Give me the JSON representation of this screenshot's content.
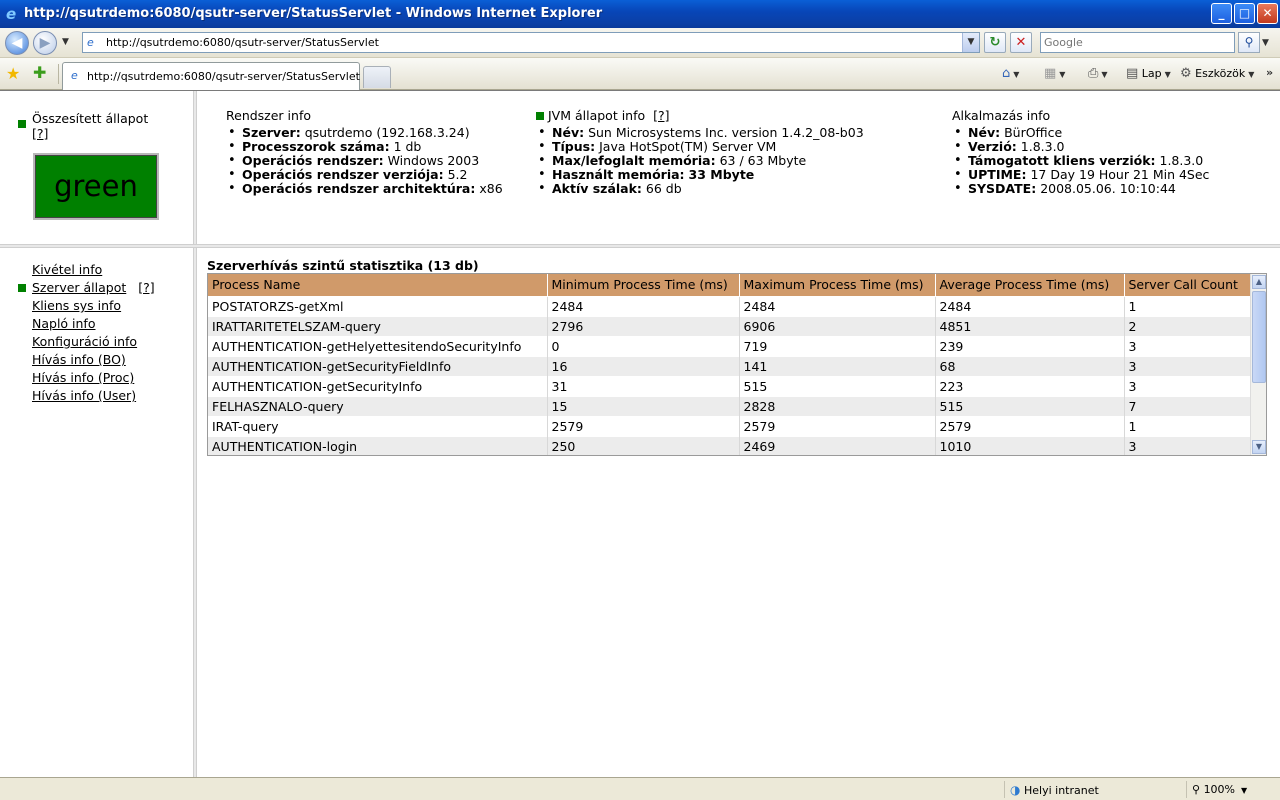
{
  "window": {
    "title": "http://qsutrdemo:6080/qsutr-server/StatusServlet - Windows Internet Explorer",
    "minimize": "_",
    "maximize": "□",
    "close": "✕"
  },
  "address_bar": {
    "url": "http://qsutrdemo:6080/qsutr-server/StatusServlet",
    "search_placeholder": "Google"
  },
  "tab": {
    "label": "http://qsutrdemo:6080/qsutr-server/StatusServlet"
  },
  "command_bar": {
    "page_label": "Lap",
    "tools_label": "Eszközök"
  },
  "overall_status": {
    "label": "Összesített állapot",
    "help": "[?]",
    "value": "green",
    "color": "#008000"
  },
  "system_info": {
    "header": "Rendszer info",
    "items": [
      {
        "key": "Szerver:",
        "value": "qsutrdemo (192.168.3.24)"
      },
      {
        "key": "Processzorok száma:",
        "value": "1 db"
      },
      {
        "key": "Operációs rendszer:",
        "value": "Windows 2003"
      },
      {
        "key": "Operációs rendszer verziója:",
        "value": "5.2"
      },
      {
        "key": "Operációs rendszer architektúra:",
        "value": "x86"
      }
    ]
  },
  "jvm_info": {
    "header": "JVM állapot info",
    "help": "[?]",
    "items": [
      {
        "key": "Név:",
        "value": "Sun Microsystems Inc. version 1.4.2_08-b03"
      },
      {
        "key": "Típus:",
        "value": "Java HotSpot(TM) Server VM"
      },
      {
        "key": "Max/lefoglalt memória:",
        "value": "63 / 63 Mbyte"
      },
      {
        "key": "Használt memória:",
        "value": "33 Mbyte"
      },
      {
        "key": "Aktív szálak:",
        "value": "66 db"
      }
    ]
  },
  "app_info": {
    "header": "Alkalmazás info",
    "items": [
      {
        "key": "Név:",
        "value": "BürOffice"
      },
      {
        "key": "Verzió:",
        "value": "1.8.3.0"
      },
      {
        "key": "Támogatott kliens verziók:",
        "value": "1.8.3.0"
      },
      {
        "key": "UPTIME:",
        "value": "17 Day 19 Hour 21 Min 4Sec"
      },
      {
        "key": "SYSDATE:",
        "value": "2008.05.06. 10:10:44"
      }
    ]
  },
  "menu": {
    "items": [
      {
        "label": "Kivétel info"
      },
      {
        "label": "Szerver állapot",
        "help": "[?]"
      },
      {
        "label": "Kliens sys info"
      },
      {
        "label": "Napló info"
      },
      {
        "label": "Konfiguráció info"
      },
      {
        "label": "Hívás info (BO)"
      },
      {
        "label": "Hívás info (Proc)"
      },
      {
        "label": "Hívás info (User)"
      }
    ]
  },
  "stats": {
    "title": "Szerverhívás szintű statisztika (13 db)",
    "columns": [
      "Process Name",
      "Minimum Process Time (ms)",
      "Maximum Process Time (ms)",
      "Average Process Time (ms)",
      "Server Call Count"
    ],
    "rows": [
      [
        "POSTATORZS-getXml",
        "2484",
        "2484",
        "2484",
        "1"
      ],
      [
        "IRATTARITETELSZAM-query",
        "2796",
        "6906",
        "4851",
        "2"
      ],
      [
        "AUTHENTICATION-getHelyettesitendoSecurityInfo",
        "0",
        "719",
        "239",
        "3"
      ],
      [
        "AUTHENTICATION-getSecurityFieldInfo",
        "16",
        "141",
        "68",
        "3"
      ],
      [
        "AUTHENTICATION-getSecurityInfo",
        "31",
        "515",
        "223",
        "3"
      ],
      [
        "FELHASZNALO-query",
        "15",
        "2828",
        "515",
        "7"
      ],
      [
        "IRAT-query",
        "2579",
        "2579",
        "2579",
        "1"
      ],
      [
        "AUTHENTICATION-login",
        "250",
        "2469",
        "1010",
        "3"
      ]
    ]
  },
  "status_bar": {
    "zone": "Helyi intranet",
    "zoom": "100%"
  }
}
